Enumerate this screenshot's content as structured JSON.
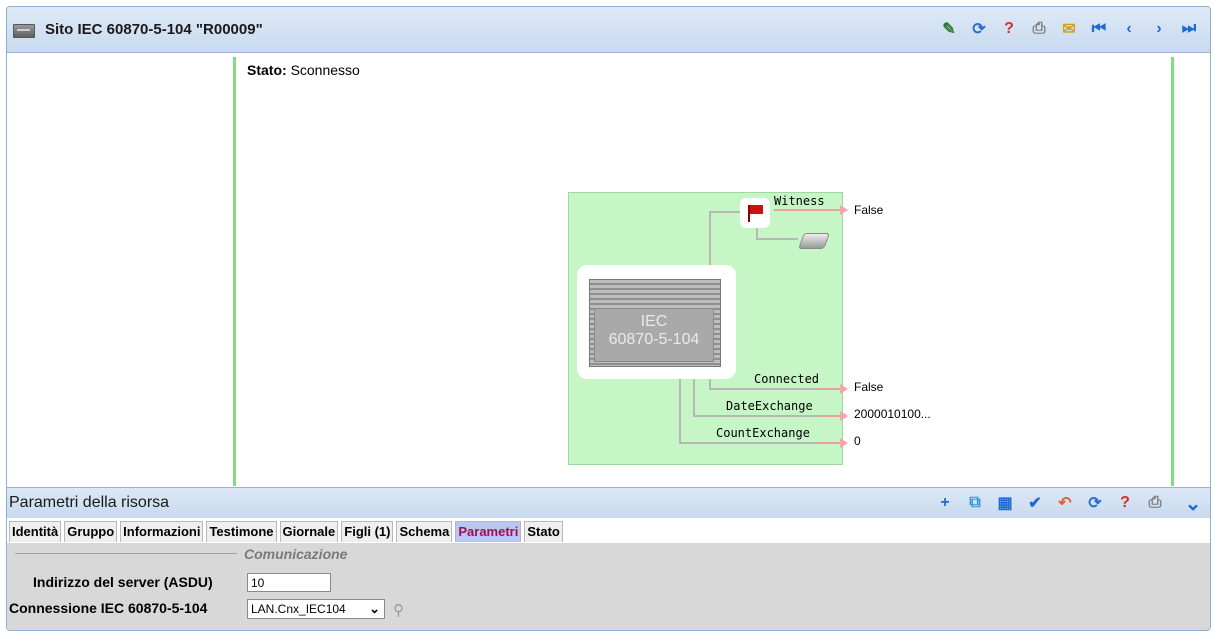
{
  "window": {
    "title": "Sito IEC 60870-5-104 \"R00009\""
  },
  "toolbar_top": [
    {
      "icon": "edit-icon",
      "glyph": "✎",
      "color": "#2e7d32"
    },
    {
      "icon": "refresh-icon",
      "glyph": "⟳",
      "color": "#2a6fd1"
    },
    {
      "icon": "help-icon",
      "glyph": "?",
      "color": "#d32f2f"
    },
    {
      "icon": "print-icon",
      "glyph": "⎙",
      "color": "#7a7a7a"
    },
    {
      "icon": "note-icon",
      "glyph": "✉",
      "color": "#d4a017"
    },
    {
      "icon": "first-icon",
      "glyph": "⏮",
      "color": "#1f6bd6"
    },
    {
      "icon": "prev-icon",
      "glyph": "‹",
      "color": "#1f6bd6"
    },
    {
      "icon": "next-icon",
      "glyph": "›",
      "color": "#1f6bd6"
    },
    {
      "icon": "last-icon",
      "glyph": "⏭",
      "color": "#1f6bd6"
    }
  ],
  "status": {
    "label": "Stato:",
    "value": "Sconnesso"
  },
  "diagram": {
    "device_label_line1": "IEC",
    "device_label_line2": "60870-5-104",
    "ports": {
      "witness": {
        "label": "Witness",
        "value": "False"
      },
      "connected": {
        "label": "Connected",
        "value": "False"
      },
      "date_exchange": {
        "label": "DateExchange",
        "value": "2000010100..."
      },
      "count_exchange": {
        "label": "CountExchange",
        "value": "0"
      }
    }
  },
  "panel": {
    "title": "Parametri della risorsa",
    "toolbar": [
      {
        "icon": "add-icon",
        "glyph": "+",
        "color": "#1f6bd6"
      },
      {
        "icon": "copy-icon",
        "glyph": "⧉",
        "color": "#2e9bd6"
      },
      {
        "icon": "table-icon",
        "glyph": "▦",
        "color": "#1f6bd6"
      },
      {
        "icon": "check-icon",
        "glyph": "✔",
        "color": "#1f6bd6"
      },
      {
        "icon": "undo-icon",
        "glyph": "↶",
        "color": "#e0603a"
      },
      {
        "icon": "refresh-icon",
        "glyph": "⟳",
        "color": "#2a6fd1"
      },
      {
        "icon": "help-icon",
        "glyph": "?",
        "color": "#d32f2f"
      },
      {
        "icon": "print-icon",
        "glyph": "⎙",
        "color": "#7a7a7a"
      }
    ],
    "collapse_glyph": "⌄"
  },
  "tabs": [
    {
      "label": "Identità",
      "active": false
    },
    {
      "label": "Gruppo",
      "active": false
    },
    {
      "label": "Informazioni",
      "active": false
    },
    {
      "label": "Testimone",
      "active": false
    },
    {
      "label": "Giornale",
      "active": false
    },
    {
      "label": "Figli (1)",
      "active": false
    },
    {
      "label": "Schema",
      "active": false
    },
    {
      "label": "Parametri",
      "active": true
    },
    {
      "label": "Stato",
      "active": false
    }
  ],
  "form": {
    "section": "Comunicazione",
    "server_address": {
      "label": "Indirizzo del server (ASDU)",
      "value": "10"
    },
    "connection": {
      "label": "Connessione IEC 60870-5-104",
      "value": "LAN.Cnx_IEC104"
    }
  }
}
